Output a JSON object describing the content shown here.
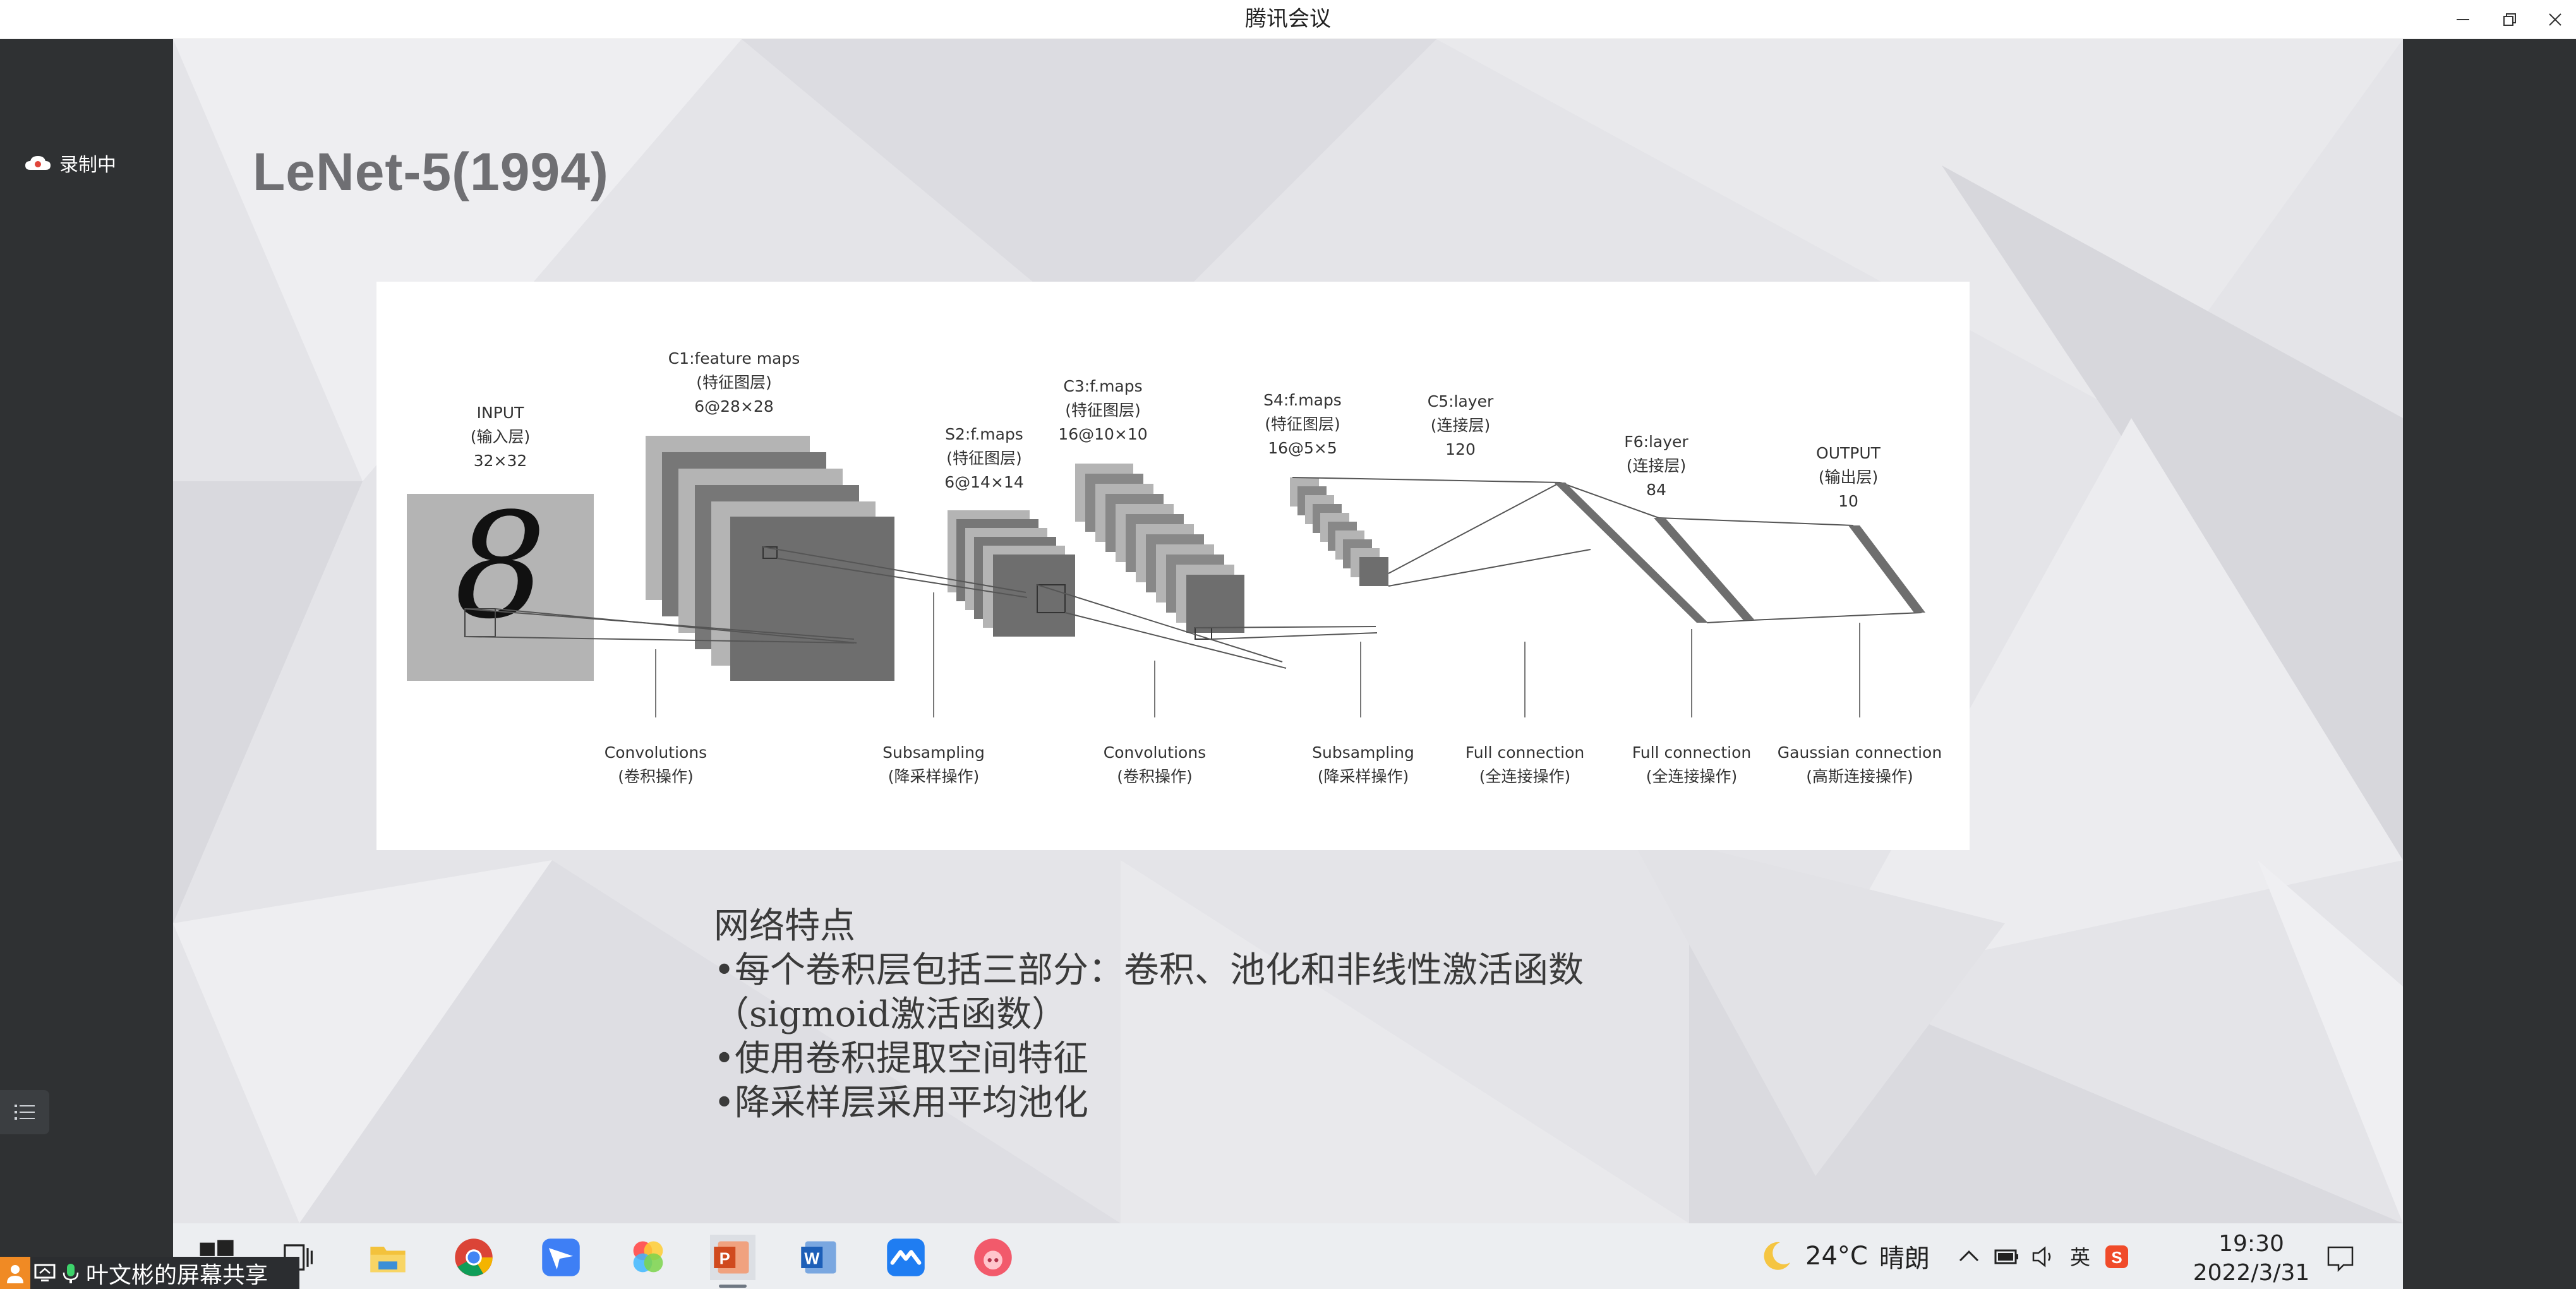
{
  "window": {
    "title": "腾讯会议",
    "controls": [
      "minimize-icon",
      "restore-icon",
      "close-icon"
    ]
  },
  "left_panel": {
    "recording_label": "录制中",
    "recording_icon": "cloud-record-icon",
    "member_list_icon": "list-icon"
  },
  "slide": {
    "title": "LeNet-5(1994)",
    "figure": {
      "layers": [
        {
          "name": "INPUT",
          "cn": "(输入层)",
          "size": "32×32"
        },
        {
          "name": "C1:feature maps",
          "cn": "(特征图层)",
          "size": "6@28×28"
        },
        {
          "name": "S2:f.maps",
          "cn": "(特征图层)",
          "size": "6@14×14"
        },
        {
          "name": "C3:f.maps",
          "cn": "(特征图层)",
          "size": "16@10×10"
        },
        {
          "name": "S4:f.maps",
          "cn": "(特征图层)",
          "size": "16@5×5"
        },
        {
          "name": "C5:layer",
          "cn": "(连接层)",
          "size": "120"
        },
        {
          "name": "F6:layer",
          "cn": "(连接层)",
          "size": "84"
        },
        {
          "name": "OUTPUT",
          "cn": "(输出层)",
          "size": "10"
        }
      ],
      "operations": [
        {
          "name": "Convolutions",
          "cn": "(卷积操作)"
        },
        {
          "name": "Subsampling",
          "cn": "(降采样操作)"
        },
        {
          "name": "Convolutions",
          "cn": "(卷积操作)"
        },
        {
          "name": "Subsampling",
          "cn": "(降采样操作)"
        },
        {
          "name": "Full connection",
          "cn": "(全连接操作)"
        },
        {
          "name": "Full connection",
          "cn": "(全连接操作)"
        },
        {
          "name": "Gaussian connection",
          "cn": "(高斯连接操作)"
        }
      ],
      "input_digit": "8"
    },
    "notes": [
      "网络特点",
      "•每个卷积层包括三部分：卷积、池化和非线性激活函数",
      "（sigmoid激活函数）",
      "•使用卷积提取空间特征",
      "•降采样层采用平均池化"
    ]
  },
  "taskbar": {
    "apps": [
      {
        "name": "windows-start-icon"
      },
      {
        "name": "task-view-icon"
      },
      {
        "name": "file-explorer-icon"
      },
      {
        "name": "chrome-icon"
      },
      {
        "name": "feishu-icon"
      },
      {
        "name": "photos-icon"
      },
      {
        "name": "powerpoint-icon"
      },
      {
        "name": "word-icon"
      },
      {
        "name": "tencent-meeting-icon"
      },
      {
        "name": "pig-app-icon"
      }
    ],
    "active_app": "powerpoint-icon",
    "weather": {
      "temp": "24°C",
      "condition": "晴朗",
      "icon": "moon-icon"
    },
    "tray": [
      "chevron-up-icon",
      "battery-icon",
      "volume-icon",
      "ime-icon",
      "sogou-input-icon"
    ],
    "ime_label": "英",
    "clock": {
      "time": "19:30",
      "date": "2022/3/31"
    },
    "notification_icon": "notification-icon"
  },
  "share_tag": {
    "label": "叶文彬的屏幕共享",
    "icons": [
      "user-icon",
      "screen-share-icon",
      "mic-icon"
    ]
  },
  "colors": {
    "dark_panel": "#2f3133",
    "slide_bg": "#e6e6e9",
    "title_gray": "#6f6f73",
    "figure_dark": "#6e6e6e",
    "figure_light": "#b4b4b4"
  }
}
